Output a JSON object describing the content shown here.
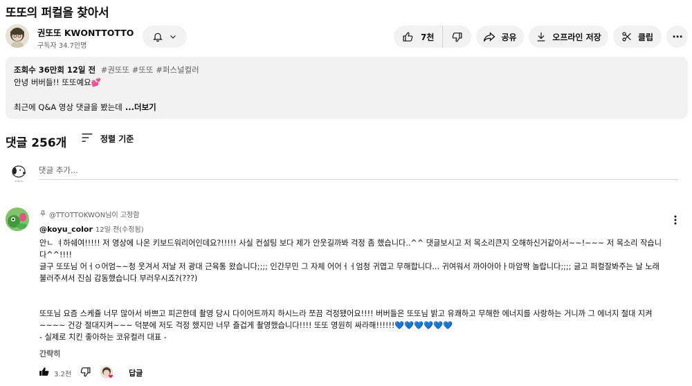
{
  "video": {
    "title": "또또의 퍼컬을 찾아서"
  },
  "channel": {
    "name": "권또또 KWONTTOTTO",
    "subscribers": "구독자 34.7만명"
  },
  "actions": {
    "like_count": "7천",
    "share_label": "공유",
    "download_label": "오프라인 저장",
    "clip_label": "클립",
    "more_label": "⋯"
  },
  "description": {
    "meta": "조회수 36만회  12일 전",
    "tags": "#권또또 #또또 #퍼스널컬러",
    "line1": "안녕 버버들!! 또또예요",
    "line1_emoji": "💕",
    "line2": "최근에 Q&A 영상 댓글을 봤는데",
    "more": " ...더보기"
  },
  "comments": {
    "header": "댓글 256개",
    "sort_label": "정렬 기준",
    "add_placeholder": "댓글 추가...",
    "pinned": {
      "pinned_by": "@TTOTTOKWON님이 고정함",
      "author": "@koyu_color",
      "time": "12일 전(수정됨)",
      "body": "안ㄴ ㅕ하쉐여!!!!! 저 영상에 나온 키보드워리어인데요?!!!!! 사실 컨설팅 보다 제가 안웃길까봐 걱정 좀 했습니다..^^ 댓글보시고 저 목소리큰지 오해하신거같아서~~!~~~ 저 목소리 작습니다^^!!!!\n글구 또또님 어ㅓㅇ어엄~~청 웃겨서 저날 저 광대 근육통 왔습니다;;;; 인간무민 그 자체 어어ㅓㅓ엄청 귀엽고 무해합니다... 귀여워서 까아아아ㅏ마암짝 놀랍니다;;;; 글고 퍼컬잘봐주는 날 노래 불러주셔서 진심 감동했습니다 부러우시죠?(???)\n\n\n또또님 요즘 스케쥴 너무 많아서 바쁘고 피곤한데 촬영 당시 다이어트까지 하시느라 쪼끔 걱정됐어요!!!! 버버들은 또또님 밝고 유쾌하고 무해한 에너지를 사랑하는 거니까 그 에너지 절대 지켜~~~~ 건강 절대지켜~~~ 덕분에 저도 걱정 했지만 너무 즐겁게 촬영했습니다!!!! 또또 영원히 싸라해!!!!!!💙💙💙💙💙💙\n- 실제로 치킨 좋아하는 코유컬러 대표 -",
      "collapse_label": "간략히",
      "like_count": "3.2천",
      "reply_label": "답글"
    }
  },
  "colors": {
    "pill_bg": "#f2f2f2",
    "secondary_text": "#606060",
    "heart": "#e0245e"
  }
}
